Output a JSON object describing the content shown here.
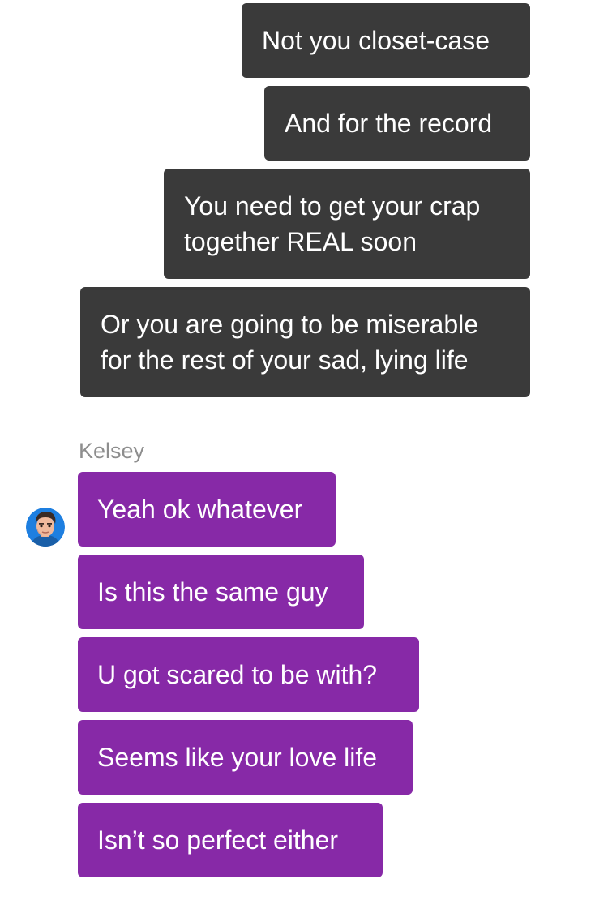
{
  "conversation": {
    "sent_messages": [
      {
        "text": "Not you closet-case"
      },
      {
        "text": "And for the record"
      },
      {
        "text": "You need to get your crap\ntogether REAL soon"
      },
      {
        "text": "Or you are going to be miserable\nfor the rest of your sad, lying life"
      }
    ],
    "contact": {
      "name": "Kelsey",
      "avatar_icon": "cartoon-boy-avatar-icon"
    },
    "received_messages": [
      {
        "text": "Yeah ok whatever"
      },
      {
        "text": "Is this the same guy"
      },
      {
        "text": "U got scared to be with?"
      },
      {
        "text": "Seems like your love life"
      },
      {
        "text": "Isn’t so perfect either"
      }
    ]
  },
  "colors": {
    "sent_bubble": "#3a3a3a",
    "received_bubble": "#8729a7",
    "sender_name": "#8e8e8e",
    "bubble_text": "#ffffff",
    "background": "#ffffff"
  }
}
